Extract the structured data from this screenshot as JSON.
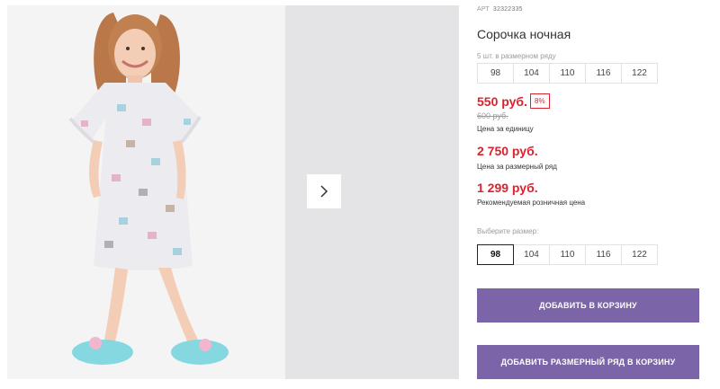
{
  "product": {
    "sku_label": "АРТ",
    "sku": "32322335",
    "title": "Сорочка ночная"
  },
  "pack": {
    "note": "5 шт. в размерном ряду",
    "sizes": [
      "98",
      "104",
      "110",
      "116",
      "122"
    ]
  },
  "prices": {
    "unit_price": "550 руб.",
    "discount": "8%",
    "old_price": "600 руб.",
    "unit_caption": "Цена за единицу",
    "pack_price": "2 750 руб.",
    "pack_caption": "Цена за размерный ряд",
    "retail_price": "1 299 руб.",
    "retail_caption": "Рекомендуемая розничная цена"
  },
  "size_select": {
    "label": "Выберите размер:",
    "sizes": [
      "98",
      "104",
      "110",
      "116",
      "122"
    ],
    "selected": "98"
  },
  "actions": {
    "add_to_cart": "ДОБАВИТЬ В КОРЗИНУ",
    "add_pack_to_cart": "ДОБАВИТЬ РАЗМЕРНЫЙ РЯД В КОРЗИНУ"
  },
  "colors": {
    "accent": "#7b64a8",
    "price": "#d9232e"
  },
  "icons": {
    "next": "chevron-right-icon"
  }
}
